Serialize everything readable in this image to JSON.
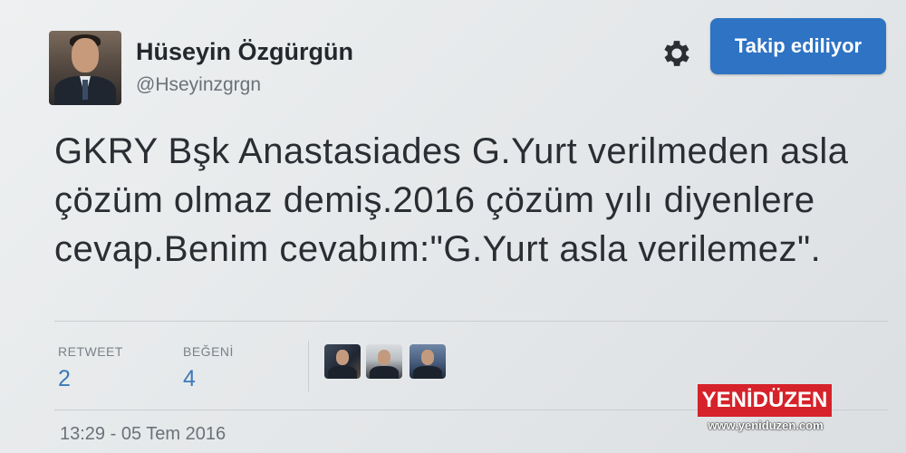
{
  "profile": {
    "name": "Hüseyin Özgürgün",
    "handle": "@Hseyinzgrgn",
    "avatar_icon": "profile-photo"
  },
  "actions": {
    "settings_icon": "gear-icon",
    "follow_label": "Takip ediliyor",
    "follow_color": "#2e73c4"
  },
  "tweet": {
    "text": "GKRY Bşk Anastasiades G.Yurt verilmeden asla çözüm olmaz demiş.2016 çözüm yılı diyenlere cevap.Benim cevabım:\"G.Yurt asla verilemez\"."
  },
  "stats": {
    "retweet_label": "RETWEET",
    "retweet_count": "2",
    "like_label": "BEĞENİ",
    "like_count": "4"
  },
  "timestamp": "13:29 - 05 Tem 2016",
  "watermark": {
    "brand": "YENİDÜZEN",
    "url": "www.yeniduzen.com"
  }
}
